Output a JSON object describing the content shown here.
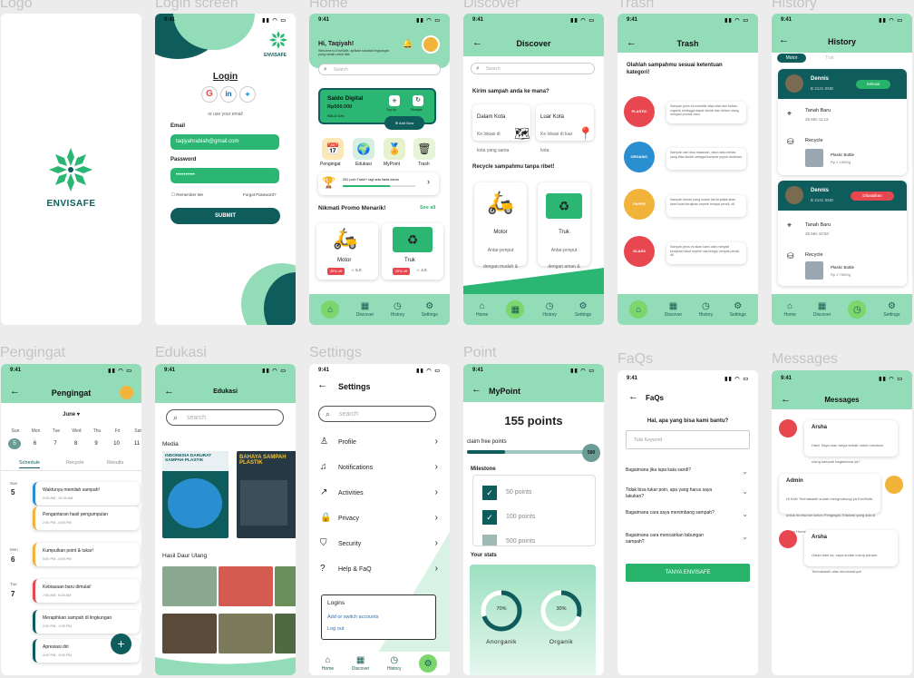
{
  "labels": {
    "logo": "Logo",
    "login": "Login screen",
    "home": "Home",
    "discover": "Discover",
    "trash": "Trash",
    "history": "History",
    "pengingat": "Pengingat",
    "edukasi": "Edukasi",
    "settings": "Settings",
    "point": "Point",
    "faqs": "FaQs",
    "messages": "Messages"
  },
  "time": "9:41",
  "brand": "ENVISAFE",
  "login": {
    "title": "Login",
    "or_email": "or use your email",
    "email_label": "Email",
    "email_value": "taqiyahrabiah@gmail.com",
    "password_label": "Password",
    "password_value": "••••••••••",
    "remember": "Remember Me",
    "forgot": "Forgot Password?",
    "submit": "SUBMIT"
  },
  "home": {
    "greeting": "Hi, Taqiyah!",
    "sub": "Welcome to EnviSafe, aplikasi sahabat lingkungan yang ramah untuk kita.",
    "search": "Search",
    "saldo_title": "Saldo Digital",
    "saldo_amount": "Rp500.000",
    "saldo_link": "Klik & Cek",
    "topup": "Top Up",
    "riwayat": "Riwayat",
    "addnow": "Add Now",
    "menu": [
      "Pengingat",
      "Edukasi",
      "MyPoint",
      "Trash"
    ],
    "points_msg": "251 poin Trash+ lagi ada harta karun",
    "promo": "Nikmati Promo Menarik!",
    "see_all": "See all",
    "promo_items": [
      {
        "name": "Motor",
        "disc": "35% off",
        "rate": "5.0"
      },
      {
        "name": "Truk",
        "disc": "25% off",
        "rate": "4.0"
      }
    ]
  },
  "nav": [
    "Home",
    "Discover",
    "History",
    "Settings"
  ],
  "discover": {
    "title": "Discover",
    "search": "Search",
    "q1": "Kirim sampah anda ke mana?",
    "dalam": "Dalam Kota",
    "dalam_sub": "Ke lokasi di kota yang sama",
    "luar": "Luar Kota",
    "luar_sub": "Ke lokasi di luar kota",
    "q2": "Recycle sampahmu tanpa ribet!",
    "motor": "Motor",
    "motor_sub": "Antar-jemput dengan mudah & cepat",
    "truk": "Truk",
    "truk_sub": "Antar-jemput dengan aman & nyaman"
  },
  "trash": {
    "title": "Trash",
    "heading": "Olahlah sampahmu sesuai ketentuan kategori!",
    "items": [
      {
        "cat": "PLASTIC",
        "color": "#e8474f",
        "desc": "Sampah jenis ini memiliki sifat-sifat dari bahan organik sehingga dapat diolah dan didaur ulang menjadi produk baru."
      },
      {
        "cat": "ORGANIC",
        "color": "#2a8fd0",
        "desc": "Sampah dari sisa makanan, daun atau kertas yang bisa diolah sebagai kompos pupuk tanaman."
      },
      {
        "cat": "PAPER",
        "color": "#f2b33a",
        "desc": "Sampah kertas yang sudah tak terpakai akan kami buat kerajinan seperti tempat pensil, dll."
      },
      {
        "cat": "GLASS",
        "color": "#e8474f",
        "desc": "Sampah jenis ini akan kami olah menjadi kerajinan kaca seperti vas bunga, tempat pensil, dll."
      }
    ]
  },
  "history": {
    "title": "History",
    "tabs": [
      "Motor",
      "Truk"
    ],
    "orders": [
      {
        "name": "Dennis",
        "plate": "B 2121 SND",
        "status": "Selesai",
        "status_color": "#27b36a",
        "address": "Tanah Baru",
        "date": "26 Mei 11:12",
        "type": "Recycle",
        "product": "Plastic Bottle",
        "price": "Rp 2.100/Kg"
      },
      {
        "name": "Dennis",
        "plate": "B 2121 SND",
        "status": "Dibatalkan",
        "status_color": "#e8474f",
        "address": "Tanah Baru",
        "date": "26 Mei 10:50",
        "type": "Recycle",
        "product": "Plastic Bottle",
        "price": "Rp 2.750/Kg"
      }
    ]
  },
  "pengingat": {
    "title": "Pengingat",
    "month": "June",
    "days": [
      {
        "d": "Sun",
        "n": "5"
      },
      {
        "d": "Mon",
        "n": "6"
      },
      {
        "d": "Tue",
        "n": "7"
      },
      {
        "d": "Wed",
        "n": "8"
      },
      {
        "d": "Thu",
        "n": "9"
      },
      {
        "d": "Fri",
        "n": "10"
      },
      {
        "d": "Sat",
        "n": "11"
      }
    ],
    "tabs": [
      "Schedule",
      "Recycle",
      "Results"
    ],
    "events": [
      {
        "text": "Waktunya memilah sampah!",
        "time": "9:00 AM - 10:30 AM",
        "color": "#2a8fd0"
      },
      {
        "text": "Pengantaran hasil pengumpulan",
        "time": "2:00 PM - 6:00 PM",
        "color": "#f2b33a"
      },
      {
        "text": "Kumpulkan point & tukar!",
        "time": "5:00 PM - 6:00 PM",
        "color": "#f2b33a"
      },
      {
        "text": "Kebiasaan baru dimulai!",
        "time": "7:50 AM - 8:20 AM",
        "color": "#e8474f"
      },
      {
        "text": "Merapihkan sampah di lingkungan",
        "time": "2:00 PM - 4:00 PM",
        "color": "#0e5d5c"
      },
      {
        "text": "Apresiasi diri",
        "time": "4:00 PM - 5:30 PM",
        "color": "#0e5d5c"
      }
    ],
    "daygroups": [
      {
        "d": "Sun",
        "n": "5"
      },
      {
        "d": "Mon",
        "n": "6"
      },
      {
        "d": "Tue",
        "n": "7"
      }
    ]
  },
  "edukasi": {
    "title": "Edukasi",
    "search": "search",
    "media": "Media",
    "poster1": "INDONESIA DARURAT SAMPAH PLASTIK",
    "poster2": "BAHAYA SAMPAH PLASTIK",
    "hasil": "Hasil Daur Ulang"
  },
  "settings": {
    "title": "Settings",
    "search": "search",
    "items": [
      "Profile",
      "Notifications",
      "Activities",
      "Privacy",
      "Security",
      "Help & FaQ"
    ],
    "logins": "Logins",
    "add": "Add or switch accounts",
    "logout": "Log out"
  },
  "point": {
    "title": "MyPoint",
    "points": "155 points",
    "claim": "claim free points",
    "claim_max": "500",
    "progress": 0.31,
    "milestone": "Milestone",
    "milestones": [
      {
        "label": "50 points",
        "done": true
      },
      {
        "label": "100 points",
        "done": true
      },
      {
        "label": "500 points",
        "done": false
      }
    ],
    "stats": "Your stats",
    "anorganik": "Anorganik",
    "anorganik_pct": "70%",
    "organik": "Organik",
    "organik_pct": "30%"
  },
  "faqs": {
    "title": "FaQs",
    "question": "Hal, apa yang bisa kami bantu?",
    "keyword": "Tulis Keyword",
    "items": [
      "Bagaimana jika lupa kata sandi?",
      "Tidak bisa tukar poin, apa yang harus saya lakukan?",
      "Bagaimana cara saya menimbang sampah?",
      "Bagaimana cara mencairkan tabungan sampah?"
    ],
    "button": "TANYA ENVISAFE"
  },
  "messages": {
    "title": "Messages",
    "items": [
      {
        "name": "Arsha",
        "text": "Halo! Saya mau tanya terkait untuk mendaur ulang sampah bagaimana ya?"
      },
      {
        "name": "Admin",
        "text": "Hi Kak! Terimakasih sudah menghubungi ya EnviSafe, untuk itu bisa ke kolom Pengingat. Edukasi yang ada di Menu Home ya..."
      },
      {
        "name": "Arsha",
        "text": "Oalah baik ka, saya sudah cukup paham. Terimakasih atas informasinya!"
      }
    ]
  }
}
